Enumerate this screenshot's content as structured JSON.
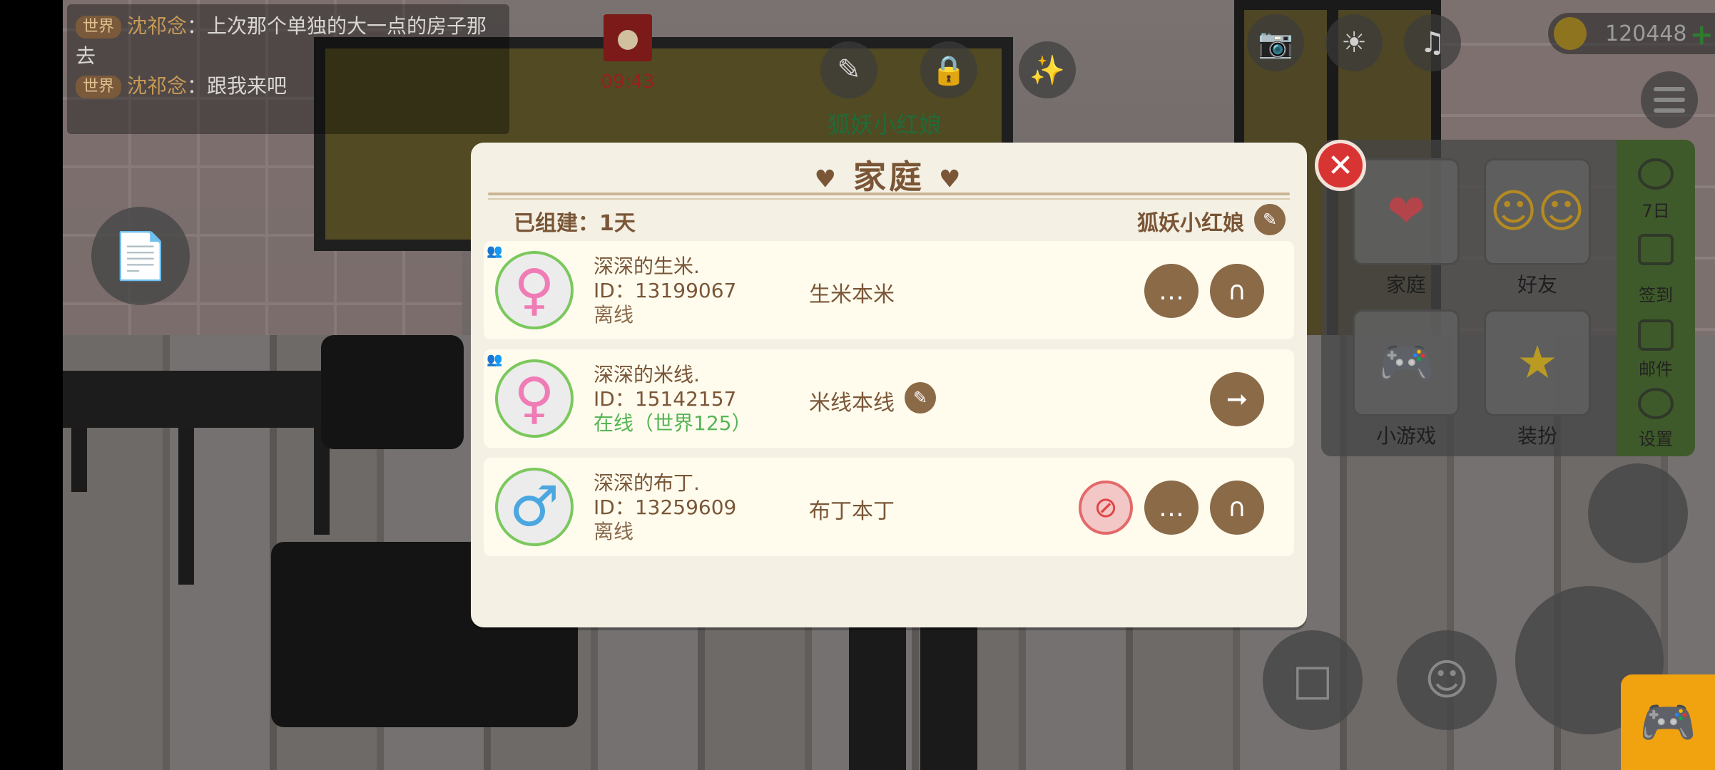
{
  "chat": {
    "messages": [
      {
        "channel": "世界",
        "sender": "沈祁念",
        "text": "：上次那个单独的大一点的房子那去"
      },
      {
        "channel": "世界",
        "sender": "沈祁念",
        "text": "：跟我来吧"
      }
    ]
  },
  "hud": {
    "envelope_time": "09:43",
    "house_owner": "狐妖小红娘",
    "coins": "120448"
  },
  "right_menu": {
    "tiles": [
      {
        "label": "家庭",
        "icon": "heart-icon"
      },
      {
        "label": "好友",
        "icon": "friends-icon"
      },
      {
        "label": "小游戏",
        "icon": "gamepad-icon"
      },
      {
        "label": "装扮",
        "icon": "magic-wand-icon"
      }
    ],
    "strip": [
      {
        "label": "7日",
        "icon": "seven-day-icon"
      },
      {
        "label": "签到",
        "icon": "checkin-icon"
      },
      {
        "label": "邮件",
        "icon": "mail-icon"
      },
      {
        "label": "设置",
        "icon": "settings-icon"
      }
    ]
  },
  "dialog": {
    "title": "家庭",
    "built_label": "已组建：1天",
    "family_name": "狐妖小红娘",
    "members": [
      {
        "name": "深深的生米.",
        "id": "ID：13199067",
        "status": "离线",
        "online": false,
        "gender": "female",
        "alias": "生米本米"
      },
      {
        "name": "深深的米线.",
        "id": "ID：15142157",
        "status": "在线（世界125）",
        "online": true,
        "gender": "female",
        "alias": "米线本线"
      },
      {
        "name": "深深的布丁.",
        "id": "ID：13259609",
        "status": "离线",
        "online": false,
        "gender": "male",
        "alias": "布丁本丁"
      }
    ]
  }
}
